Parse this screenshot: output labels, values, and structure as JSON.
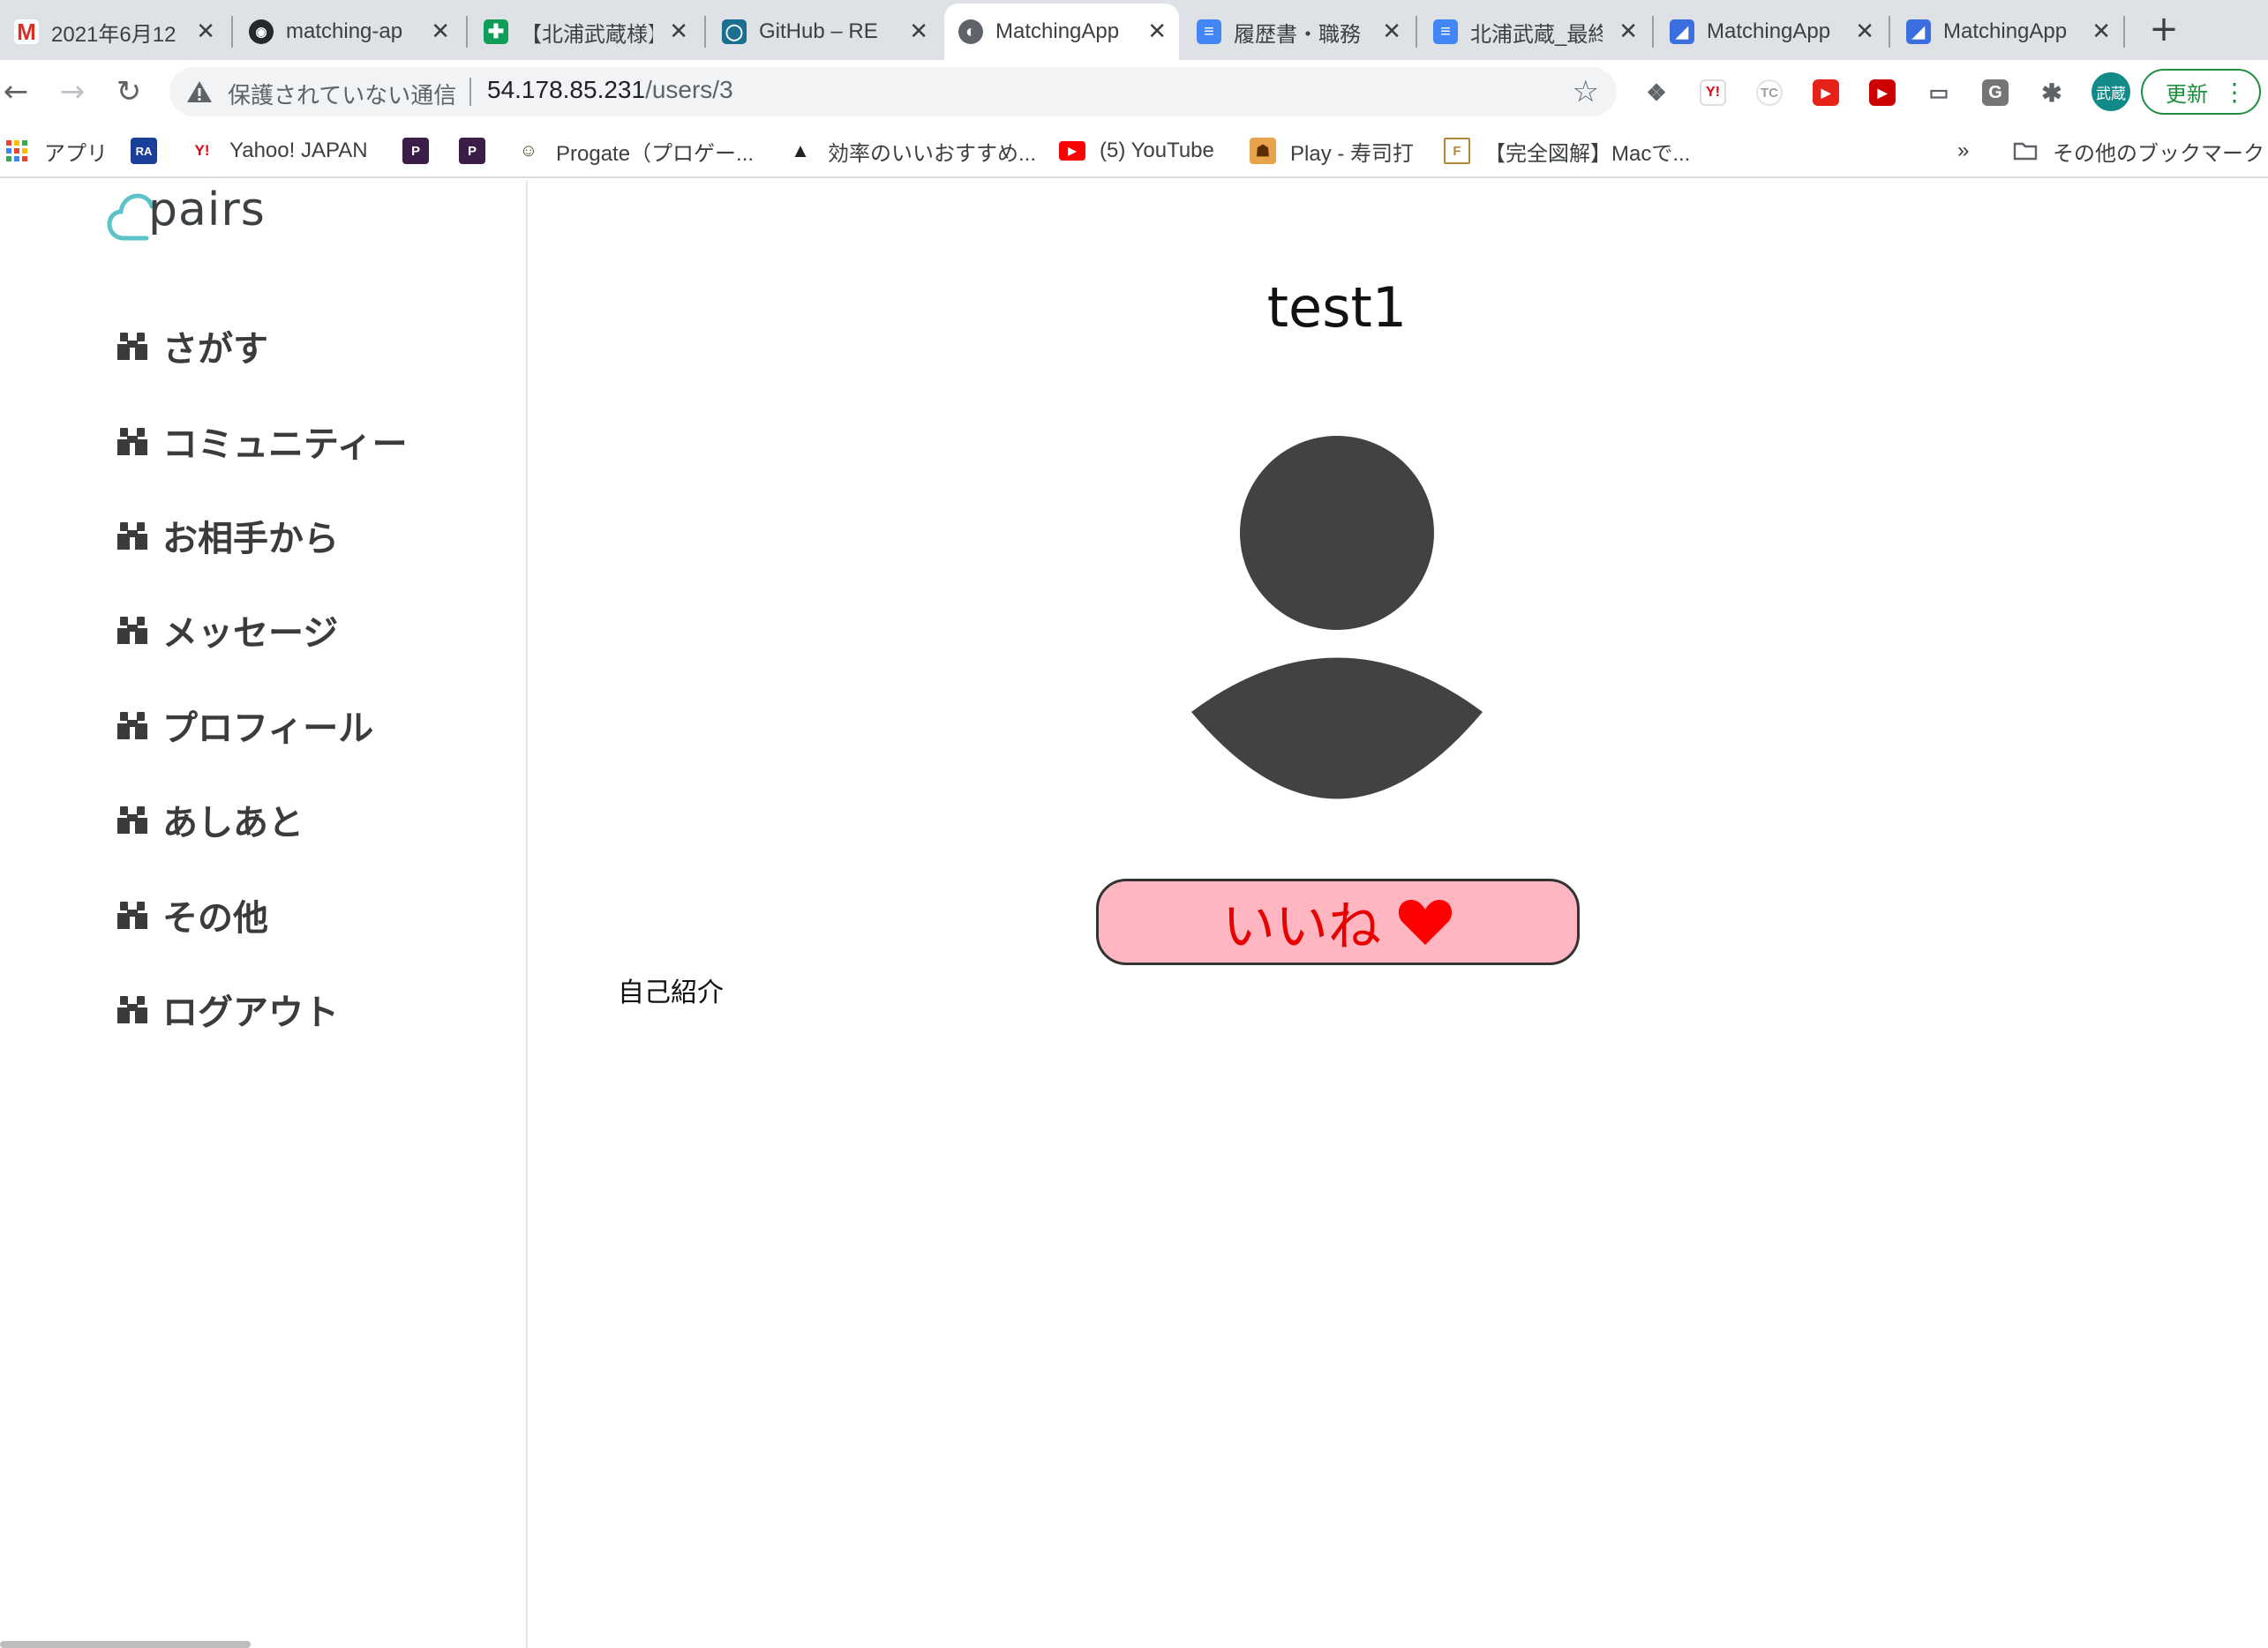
{
  "browser": {
    "tabs": [
      {
        "title": "2021年6月12",
        "favicon": "gmail-icon"
      },
      {
        "title": "matching-ap",
        "favicon": "github-icon"
      },
      {
        "title": "【北浦武蔵様】",
        "favicon": "sheets-icon"
      },
      {
        "title": "GitHub – RE",
        "favicon": "github-readme-icon"
      },
      {
        "title": "MatchingApp",
        "favicon": "globe-icon",
        "active": true
      },
      {
        "title": "履歴書・職務",
        "favicon": "docs-icon"
      },
      {
        "title": "北浦武蔵_最終",
        "favicon": "docs-icon"
      },
      {
        "title": "MatchingApp",
        "favicon": "matching-app-icon"
      },
      {
        "title": "MatchingApp",
        "favicon": "matching-app-icon"
      }
    ],
    "security_label": "保護されていない通信",
    "url_host": "54.178.85.231",
    "url_path": "/users/3",
    "profile_initials": "武蔵",
    "update_label": "更新",
    "bookmarks": [
      {
        "label": "アプリ",
        "icon": "apps-grid-icon"
      },
      {
        "label": "",
        "icon": "ra-icon"
      },
      {
        "label": "Yahoo! JAPAN",
        "icon": "yahoo-icon"
      },
      {
        "label": "",
        "icon": "p-icon"
      },
      {
        "label": "",
        "icon": "p-icon"
      },
      {
        "label": "Progate（プロゲー...",
        "icon": "progate-icon"
      },
      {
        "label": "効率のいいおすすめ...",
        "icon": "triangle-icon"
      },
      {
        "label": "(5) YouTube",
        "icon": "youtube-icon"
      },
      {
        "label": "Play - 寿司打",
        "icon": "sushida-icon"
      },
      {
        "label": "【完全図解】Macで...",
        "icon": "f-icon"
      }
    ],
    "bookmarks_overflow": "»",
    "other_bookmarks": "その他のブックマーク"
  },
  "app": {
    "logo_text": "pairs",
    "nav": [
      {
        "label": "さがす"
      },
      {
        "label": "コミュニティー"
      },
      {
        "label": "お相手から"
      },
      {
        "label": "メッセージ"
      },
      {
        "label": "プロフィール"
      },
      {
        "label": "あしあと"
      },
      {
        "label": "その他"
      },
      {
        "label": "ログアウト"
      }
    ]
  },
  "profile": {
    "username": "test1",
    "like_label": "いいね",
    "intro_label": "自己紹介"
  },
  "colors": {
    "like_bg": "#ffb6c1",
    "like_text": "#e60000",
    "avatar": "#424242",
    "logo_accent": "#5bc3c9",
    "update_green": "#1e8e3e"
  }
}
